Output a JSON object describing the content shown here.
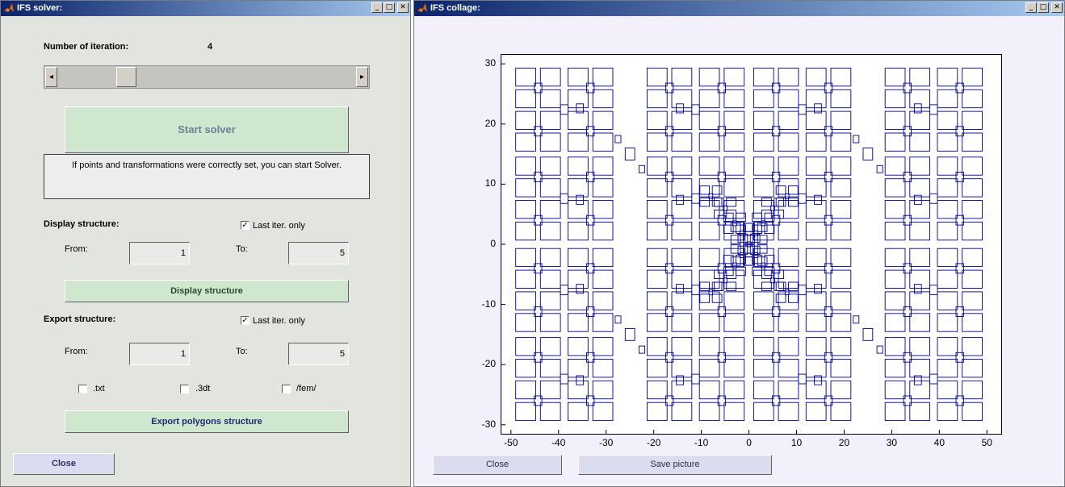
{
  "solver": {
    "title": "IFS solver:",
    "iteration_label": "Number of iteration:",
    "iteration_value": "4",
    "slider_arrow_left": "◂",
    "slider_arrow_right": "▸",
    "start_button": "Start solver",
    "info_text": "If points and transformations were correctly set, you can start Solver.",
    "display": {
      "heading": "Display  structure:",
      "last_iter_label": "Last iter. only",
      "last_iter_checked": "✓",
      "from_label": "From:",
      "from_value": "1",
      "to_label": "To:",
      "to_value": "5",
      "button": "Display structure"
    },
    "export": {
      "heading": "Export structure:",
      "last_iter_label": "Last iter. only",
      "last_iter_checked": "✓",
      "from_label": "From:",
      "from_value": "1",
      "to_label": "To:",
      "to_value": "5",
      "opt_txt": ".txt",
      "opt_3dt": ".3dt",
      "opt_fem": "/fem/",
      "button": "Export polygons structure"
    },
    "close_button": "Close"
  },
  "collage": {
    "title": "IFS collage:",
    "close_button": "Close",
    "save_button": "Save picture"
  },
  "window_buttons": {
    "minimize": "_",
    "maximize": "□",
    "close": "✕"
  },
  "colors": {
    "plot_line": "#00008b",
    "green_button": "#cfe6cf",
    "lavender_button": "#dcdcf0"
  },
  "chart_data": {
    "type": "scatter",
    "xlim": [
      -52,
      53
    ],
    "ylim": [
      -31.5,
      31.5
    ],
    "x_ticks": [
      "-50",
      "-40",
      "-30",
      "-20",
      "-10",
      "0",
      "10",
      "20",
      "30",
      "40",
      "50"
    ],
    "y_ticks": [
      "30",
      "20",
      "10",
      "0",
      "-10",
      "-20",
      "-30"
    ],
    "x_tick_values": [
      -50,
      -40,
      -30,
      -20,
      -10,
      0,
      10,
      20,
      30,
      40,
      50
    ],
    "y_tick_values": [
      30,
      20,
      10,
      0,
      -10,
      -20,
      -30
    ],
    "grid": false
  }
}
